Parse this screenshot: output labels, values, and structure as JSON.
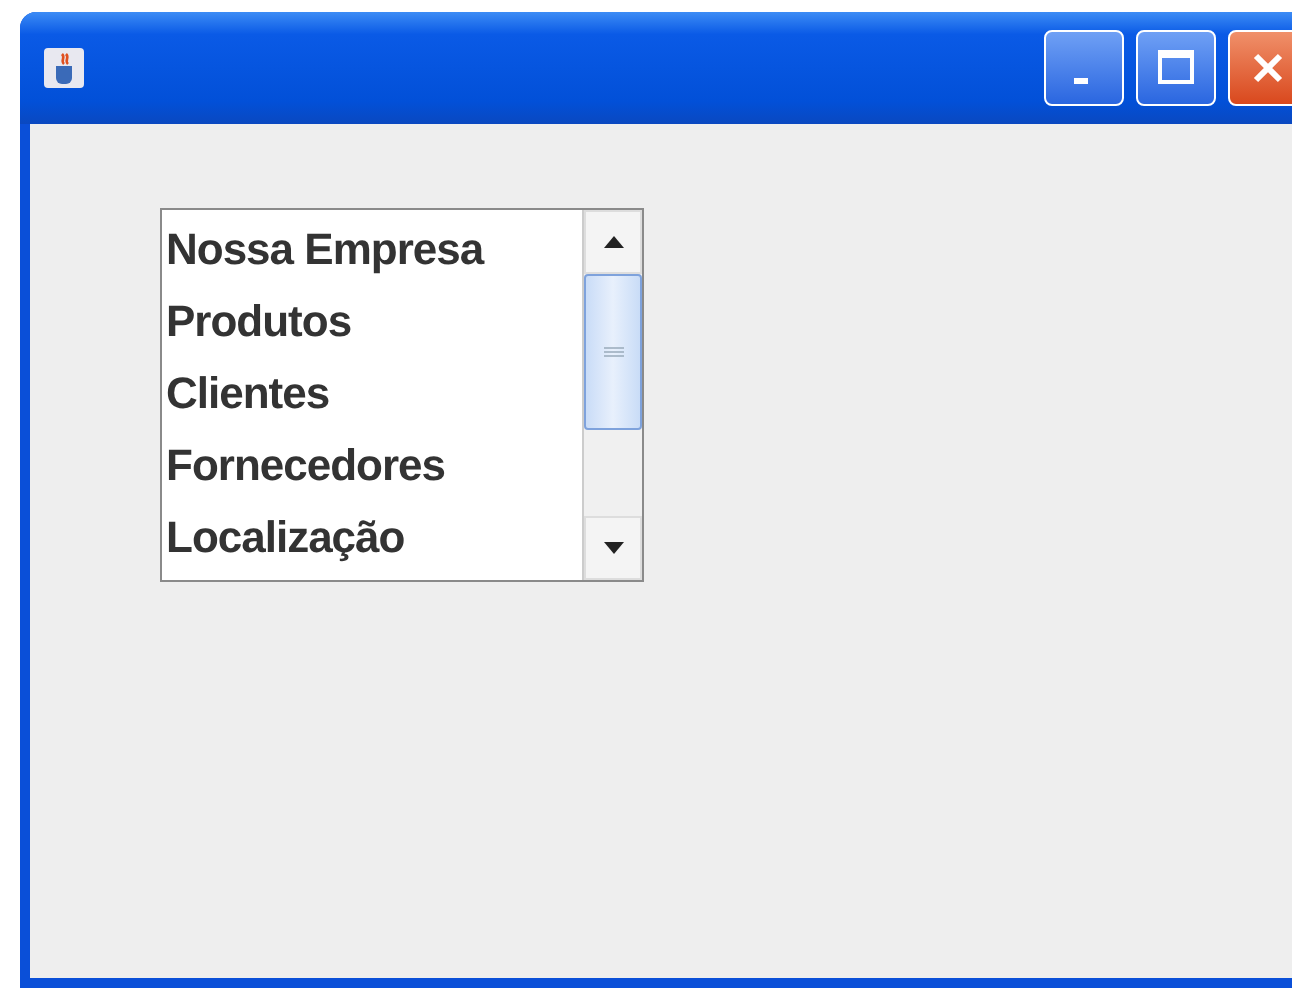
{
  "list": {
    "items": [
      {
        "label": "Nossa Empresa"
      },
      {
        "label": "Produtos"
      },
      {
        "label": "Clientes"
      },
      {
        "label": "Fornecedores"
      },
      {
        "label": "Localização"
      }
    ]
  }
}
